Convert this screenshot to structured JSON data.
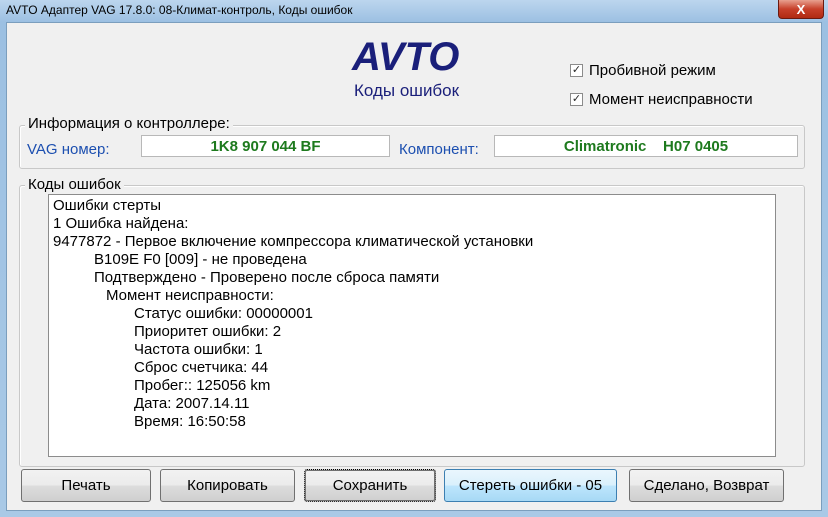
{
  "window": {
    "title": "AVTO Адаптер VAG 17.8.0: 08-Климат-контроль,  Коды ошибок",
    "close_glyph": "X"
  },
  "header": {
    "logo": "AVTO",
    "subtitle": "Коды ошибок"
  },
  "options": {
    "test_mode": {
      "label": "Пробивной режим",
      "checked": true
    },
    "fault_moment": {
      "label": "Момент неисправности",
      "checked": true
    }
  },
  "controller": {
    "group_label": "Информация о контроллере:",
    "vag_label": "VAG номер:",
    "vag_value": "1K8 907 044 BF",
    "component_label": "Компонент:",
    "component_value": "Climatronic    H07 0405"
  },
  "faults": {
    "group_label": "Коды ошибок",
    "lines": [
      "Ошибки стерты",
      "1 Ошибка найдена:",
      "9477872 - Первое включение компрессора климатической установки",
      "B109E F0 [009] - не проведена",
      "Подтверждено - Проверено после сброса памяти",
      "Момент неисправности:",
      "Статус ошибки: 00000001",
      "Приоритет ошибки: 2",
      "Частота ошибки: 1",
      "Сброс счетчика: 44",
      "Пробег:: 125056 km",
      "Дата: 2007.14.11",
      "Время: 16:50:58"
    ]
  },
  "buttons": {
    "print": "Печать",
    "copy": "Копировать",
    "save": "Сохранить",
    "clear": "Стереть ошибки - 05",
    "done": "Сделано, Возврат"
  }
}
